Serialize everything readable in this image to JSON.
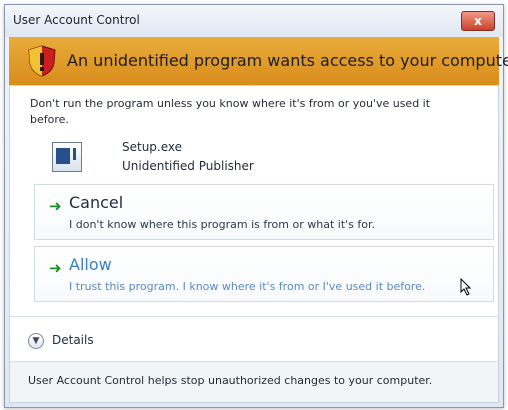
{
  "window": {
    "title": "User Account Control",
    "close_symbol": "x"
  },
  "banner": {
    "text": "An unidentified program wants access to your computer",
    "icon": "shield-warning-icon"
  },
  "message": {
    "text": "Don't run the program unless you know where it's from or you've used it before."
  },
  "program": {
    "name": "Setup.exe",
    "publisher": "Unidentified Publisher",
    "icon": "program-icon"
  },
  "options": {
    "cancel": {
      "label": "Cancel",
      "description": "I don't know where this program is from or what it's for.",
      "icon": "green-arrow-icon"
    },
    "allow": {
      "label": "Allow",
      "description": "I trust this program. I know where it's from or I've used it before.",
      "icon": "green-arrow-icon"
    }
  },
  "details": {
    "label": "Details",
    "icon": "chevron-down-icon"
  },
  "footer": {
    "text": "User Account Control helps stop unauthorized changes to your computer."
  },
  "colors": {
    "banner": "#e2a232",
    "allow_text": "#3a7ec7",
    "arrow": "#1d8d28"
  }
}
